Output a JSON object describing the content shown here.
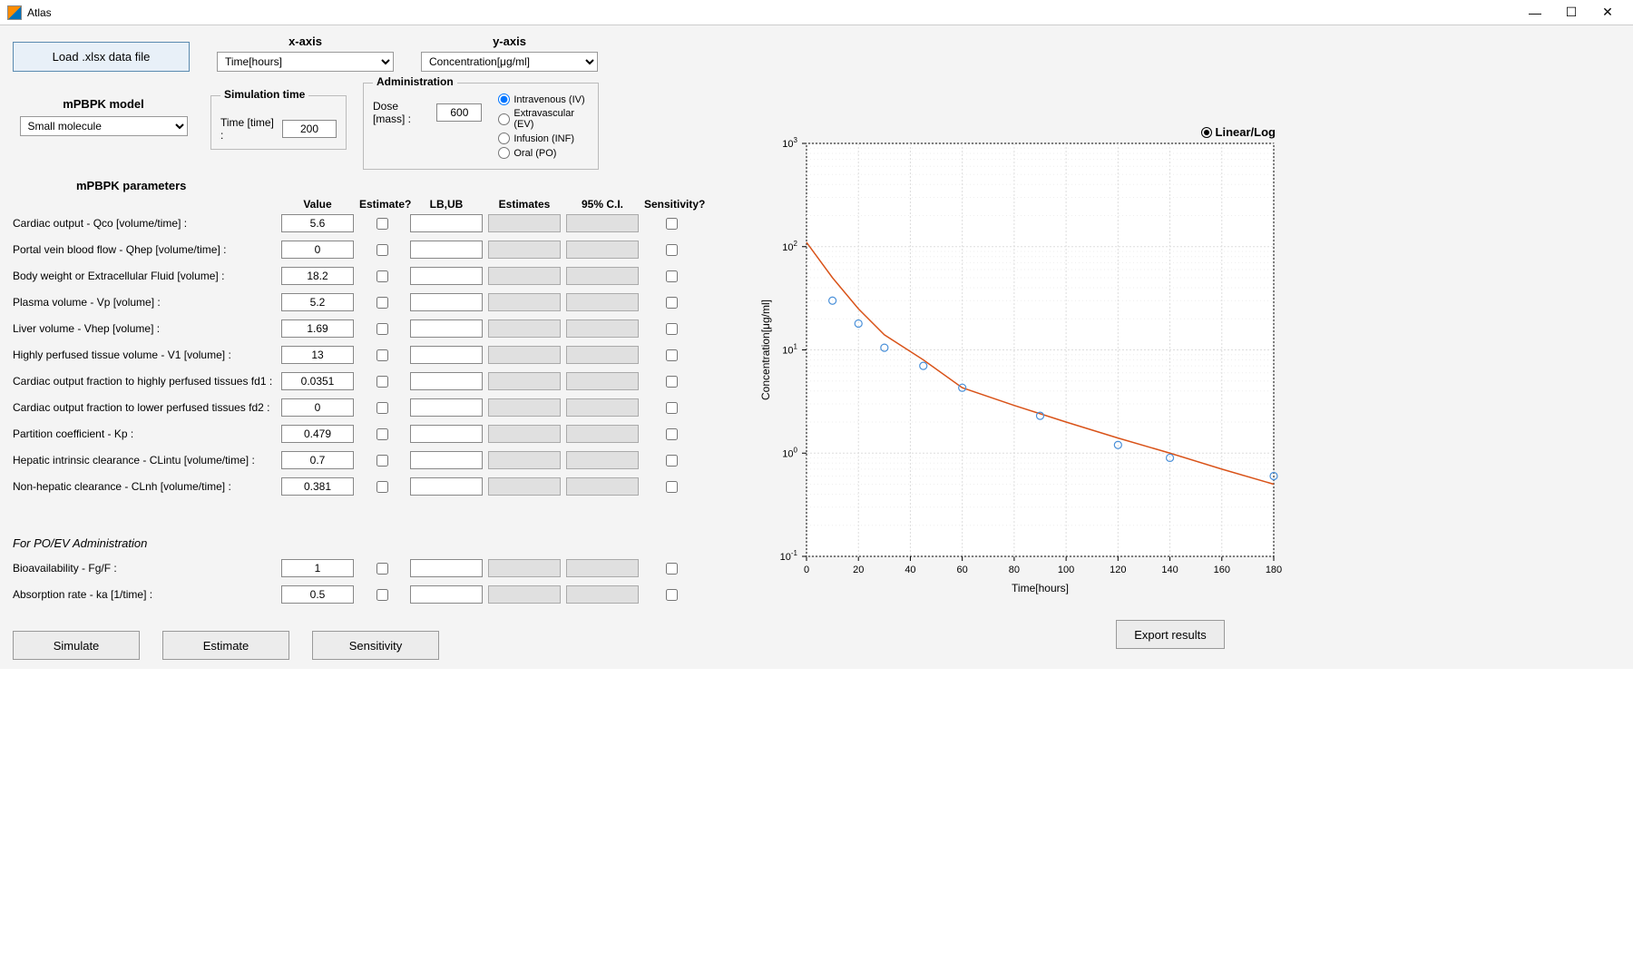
{
  "window": {
    "title": "Atlas"
  },
  "top": {
    "load_button": "Load .xlsx data file",
    "x_axis_label": "x-axis",
    "y_axis_label": "y-axis",
    "x_axis_value": "Time[hours]",
    "y_axis_value": "Concentration[μg/ml]"
  },
  "model": {
    "label": "mPBPK model",
    "value": "Small molecule"
  },
  "simulation": {
    "legend": "Simulation time",
    "time_label": "Time [time] :",
    "time_value": "200"
  },
  "administration": {
    "legend": "Administration",
    "dose_label": "Dose [mass] :",
    "dose_value": "600",
    "options": [
      "Intravenous (IV)",
      "Extravascular (EV)",
      "Infusion (INF)",
      "Oral (PO)"
    ],
    "selected": 0
  },
  "params": {
    "section_title": "mPBPK parameters",
    "headers": {
      "value": "Value",
      "estimate": "Estimate?",
      "lbub": "LB,UB",
      "estimates": "Estimates",
      "ci": "95% C.I.",
      "sensitivity": "Sensitivity?"
    },
    "rows": [
      {
        "label": "Cardiac output - Qco [volume/time] :",
        "value": "5.6"
      },
      {
        "label": "Portal vein blood flow - Qhep [volume/time] :",
        "value": "0"
      },
      {
        "label": "Body weight or Extracellular Fluid [volume] :",
        "value": "18.2"
      },
      {
        "label": "Plasma volume - Vp [volume] :",
        "value": "5.2"
      },
      {
        "label": "Liver volume - Vhep [volume] :",
        "value": "1.69"
      },
      {
        "label": "Highly perfused tissue volume - V1 [volume] :",
        "value": "13"
      },
      {
        "label": "Cardiac output fraction to highly perfused tissues fd1 :",
        "value": "0.0351"
      },
      {
        "label": "Cardiac output fraction to lower perfused tissues fd2 :",
        "value": "0"
      },
      {
        "label": "Partition coefficient - Kp :",
        "value": "0.479"
      },
      {
        "label": "Hepatic intrinsic clearance - CLintu [volume/time] :",
        "value": "0.7"
      },
      {
        "label": "Non-hepatic clearance - CLnh [volume/time] :",
        "value": "0.381"
      }
    ],
    "subsection": "For PO/EV Administration",
    "poev_rows": [
      {
        "label": "Bioavailability - Fg/F :",
        "value": "1"
      },
      {
        "label": "Absorption rate - ka [1/time] :",
        "value": "0.5"
      }
    ]
  },
  "buttons": {
    "simulate": "Simulate",
    "estimate": "Estimate",
    "sensitivity": "Sensitivity",
    "export": "Export results"
  },
  "chart": {
    "linear_log": "Linear/Log",
    "xlabel": "Time[hours]",
    "ylabel": "Concentration[μg/ml]"
  },
  "chart_data": {
    "type": "line",
    "xlabel": "Time[hours]",
    "ylabel": "Concentration[μg/ml]",
    "xlim": [
      0,
      180
    ],
    "ylim_log": [
      -1,
      3
    ],
    "x_ticks": [
      0,
      20,
      40,
      60,
      80,
      100,
      120,
      140,
      160,
      180
    ],
    "y_tick_exponents": [
      -1,
      0,
      1,
      2,
      3
    ],
    "scatter": [
      {
        "x": 10,
        "y": 30
      },
      {
        "x": 20,
        "y": 18
      },
      {
        "x": 30,
        "y": 10.5
      },
      {
        "x": 45,
        "y": 7
      },
      {
        "x": 60,
        "y": 4.3
      },
      {
        "x": 90,
        "y": 2.3
      },
      {
        "x": 120,
        "y": 1.2
      },
      {
        "x": 140,
        "y": 0.9
      },
      {
        "x": 180,
        "y": 0.6
      }
    ],
    "fit_line": [
      {
        "x": 0,
        "y": 110
      },
      {
        "x": 10,
        "y": 50
      },
      {
        "x": 20,
        "y": 25
      },
      {
        "x": 30,
        "y": 14
      },
      {
        "x": 45,
        "y": 8
      },
      {
        "x": 60,
        "y": 4.3
      },
      {
        "x": 80,
        "y": 2.9
      },
      {
        "x": 100,
        "y": 2.0
      },
      {
        "x": 120,
        "y": 1.4
      },
      {
        "x": 140,
        "y": 1.0
      },
      {
        "x": 160,
        "y": 0.7
      },
      {
        "x": 180,
        "y": 0.5
      }
    ]
  }
}
